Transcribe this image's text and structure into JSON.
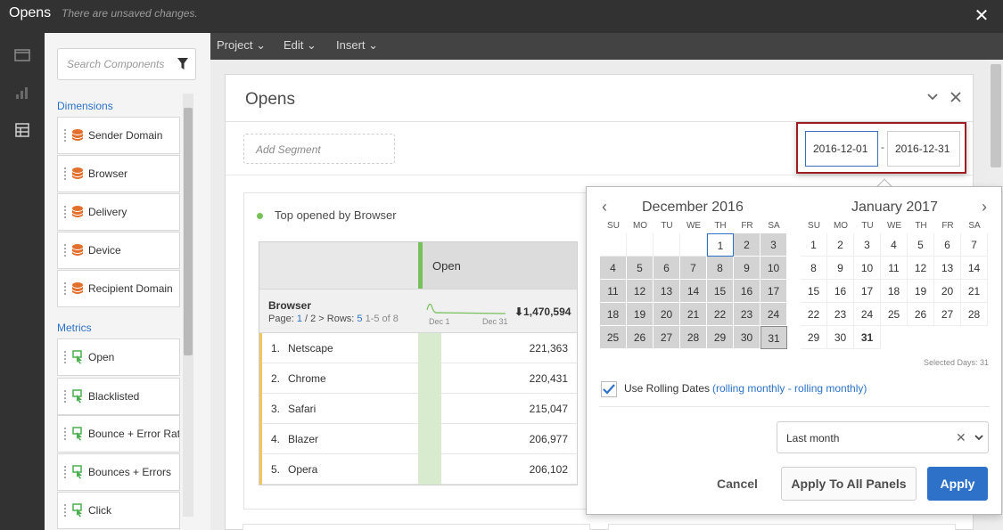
{
  "app": {
    "title": "Opens",
    "unsaved": "There are unsaved changes.",
    "close_glyph": "✕"
  },
  "menu": {
    "items": [
      {
        "label": "Project ⌄"
      },
      {
        "label": "Edit ⌄"
      },
      {
        "label": "Insert ⌄"
      }
    ]
  },
  "left": {
    "search_placeholder": "Search Components",
    "dimensions_label": "Dimensions",
    "metrics_label": "Metrics",
    "dimensions": [
      {
        "label": "Sender Domain"
      },
      {
        "label": "Browser"
      },
      {
        "label": "Delivery"
      },
      {
        "label": "Device"
      },
      {
        "label": "Recipient Domain"
      }
    ],
    "metrics": [
      {
        "label": "Open"
      },
      {
        "label": "Blacklisted"
      },
      {
        "label": "Bounce + Error Rat"
      },
      {
        "label": "Bounces + Errors"
      },
      {
        "label": "Click"
      }
    ]
  },
  "panel": {
    "title": "Opens",
    "add_segment": "Add Segment",
    "date_start": "2016-12-01",
    "date_end": "2016-12-31",
    "date_dash": "-"
  },
  "viz": {
    "title": "Top opened by Browser",
    "column": "Open",
    "dimension": "Browser",
    "pager": {
      "page_label": "Page: ",
      "page": "1",
      "sep": " / 2 ",
      "rows_label": " Rows: ",
      "rows": "5",
      "range": "1-5 of 8"
    },
    "spark_start": "Dec 1",
    "spark_end": "Dec 31",
    "total": "⬇1,470,594",
    "rows": [
      {
        "idx": "1.",
        "name": "Netscape",
        "value": "221,363"
      },
      {
        "idx": "2.",
        "name": "Chrome",
        "value": "220,431"
      },
      {
        "idx": "3.",
        "name": "Safari",
        "value": "215,047"
      },
      {
        "idx": "4.",
        "name": "Blazer",
        "value": "206,977"
      },
      {
        "idx": "5.",
        "name": "Opera",
        "value": "206,102"
      }
    ]
  },
  "calendar": {
    "month1": "December  2016",
    "month2": "January  2017",
    "dows": [
      "SU",
      "MO",
      "TU",
      "WE",
      "TH",
      "FR",
      "SA"
    ],
    "selected_days": "Selected Days: 31",
    "rolling_label": "Use Rolling Dates",
    "rolling_detail": "(rolling monthly - rolling monthly)",
    "preset": "Last month",
    "cancel": "Cancel",
    "apply_all": "Apply To All Panels",
    "apply": "Apply",
    "accent": "#2d72c8"
  }
}
